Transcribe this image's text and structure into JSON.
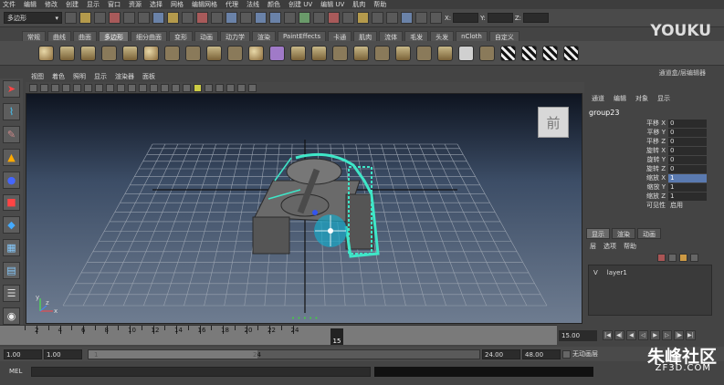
{
  "menubar": {
    "items": [
      "文件",
      "编辑",
      "修改",
      "创建",
      "显示",
      "窗口",
      "资源",
      "选择",
      "网格",
      "编辑网格",
      "代理",
      "法线",
      "颜色",
      "创建 UV",
      "编辑 UV",
      "肌肉",
      "帮助"
    ]
  },
  "statusline": {
    "mode": "多边形",
    "coords": {
      "x_label": "X:",
      "y_label": "Y:",
      "z_label": "Z:"
    }
  },
  "shelf": {
    "tabs": [
      "常规",
      "曲线",
      "曲面",
      "多边形",
      "细分曲面",
      "变形",
      "动画",
      "动力学",
      "渲染",
      "PaintEffects",
      "卡通",
      "肌肉",
      "流体",
      "毛发",
      "头发",
      "nCloth",
      "自定义"
    ],
    "active": 3
  },
  "viewport": {
    "menu": [
      "视图",
      "着色",
      "照明",
      "显示",
      "渲染器",
      "面板"
    ],
    "cube_label": "前",
    "axis_labels": {
      "y": "y",
      "x": "x",
      "z": "z"
    }
  },
  "channel_box": {
    "title": "通道盒/层编辑器",
    "menu": [
      "通道",
      "编辑",
      "对象",
      "显示"
    ],
    "object": "group23",
    "attributes": [
      {
        "label": "平移 X",
        "value": "0"
      },
      {
        "label": "平移 Y",
        "value": "0"
      },
      {
        "label": "平移 Z",
        "value": "0"
      },
      {
        "label": "旋转 X",
        "value": "0"
      },
      {
        "label": "旋转 Y",
        "value": "0"
      },
      {
        "label": "旋转 Z",
        "value": "0"
      },
      {
        "label": "缩放 X",
        "value": "1",
        "highlight": true
      },
      {
        "label": "缩放 Y",
        "value": "1"
      },
      {
        "label": "缩放 Z",
        "value": "1"
      },
      {
        "label": "可见性",
        "value": "启用"
      }
    ]
  },
  "layers": {
    "tabs": [
      "显示",
      "渲染",
      "动画"
    ],
    "menu": [
      "层",
      "选项",
      "帮助"
    ],
    "rows": [
      {
        "vis": "V",
        "name": "layer1"
      }
    ]
  },
  "timeline": {
    "ticks": [
      "2",
      "4",
      "6",
      "8",
      "10",
      "12",
      "14",
      "16",
      "18",
      "20",
      "22",
      "24"
    ],
    "current": "15",
    "end": "15.00"
  },
  "range": {
    "start": "1.00",
    "start2": "1.00",
    "handle_start": "1",
    "handle_end": "24",
    "end1": "24.00",
    "end2": "48.00",
    "char_set": "无动画层"
  },
  "command": {
    "label": "MEL"
  },
  "watermarks": {
    "youku": "YOUKU",
    "youku_cn": "优酷",
    "zf3d_cn": "朱峰社区",
    "zf3d": "ZF3D.COM"
  }
}
